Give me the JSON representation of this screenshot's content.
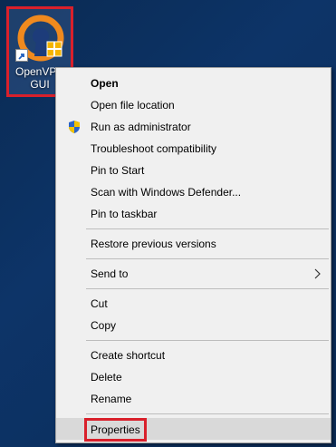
{
  "desktop": {
    "shortcut": {
      "label": "OpenVPN\nGUI",
      "icon": "openvpn-shortcut-icon"
    }
  },
  "context_menu": {
    "groups": [
      [
        {
          "label": "Open",
          "bold": true
        },
        {
          "label": "Open file location"
        },
        {
          "label": "Run as administrator",
          "icon": "uac-shield-icon"
        },
        {
          "label": "Troubleshoot compatibility"
        },
        {
          "label": "Pin to Start"
        },
        {
          "label": "Scan with Windows Defender..."
        },
        {
          "label": "Pin to taskbar"
        }
      ],
      [
        {
          "label": "Restore previous versions"
        }
      ],
      [
        {
          "label": "Send to",
          "submenu": true
        }
      ],
      [
        {
          "label": "Cut"
        },
        {
          "label": "Copy"
        }
      ],
      [
        {
          "label": "Create shortcut"
        },
        {
          "label": "Delete"
        },
        {
          "label": "Rename"
        }
      ],
      [
        {
          "label": "Properties",
          "highlighted": true
        }
      ]
    ]
  },
  "colors": {
    "highlight_box": "#d9202b",
    "menu_background": "#f0f0f0",
    "hover_background": "#d9d9d9"
  }
}
